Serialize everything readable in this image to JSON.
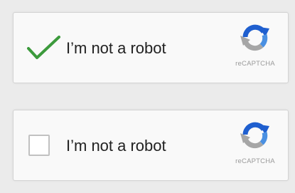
{
  "widgets": [
    {
      "state": "checked",
      "label": "I’m not a robot",
      "brand": "reCAPTCHA",
      "checkmark_icon": "green-checkmark",
      "logo_icon": "recaptcha-logo"
    },
    {
      "state": "unchecked",
      "label": "I’m not a robot",
      "brand": "reCAPTCHA",
      "logo_icon": "recaptcha-logo"
    }
  ],
  "colors": {
    "check_green": "#3c9a3c",
    "logo_blue_dark": "#1f5fcf",
    "logo_blue_light": "#4a90e2",
    "logo_gray": "#a6a6a6",
    "background": "#ebebeb",
    "panel": "#f9f9f9"
  }
}
